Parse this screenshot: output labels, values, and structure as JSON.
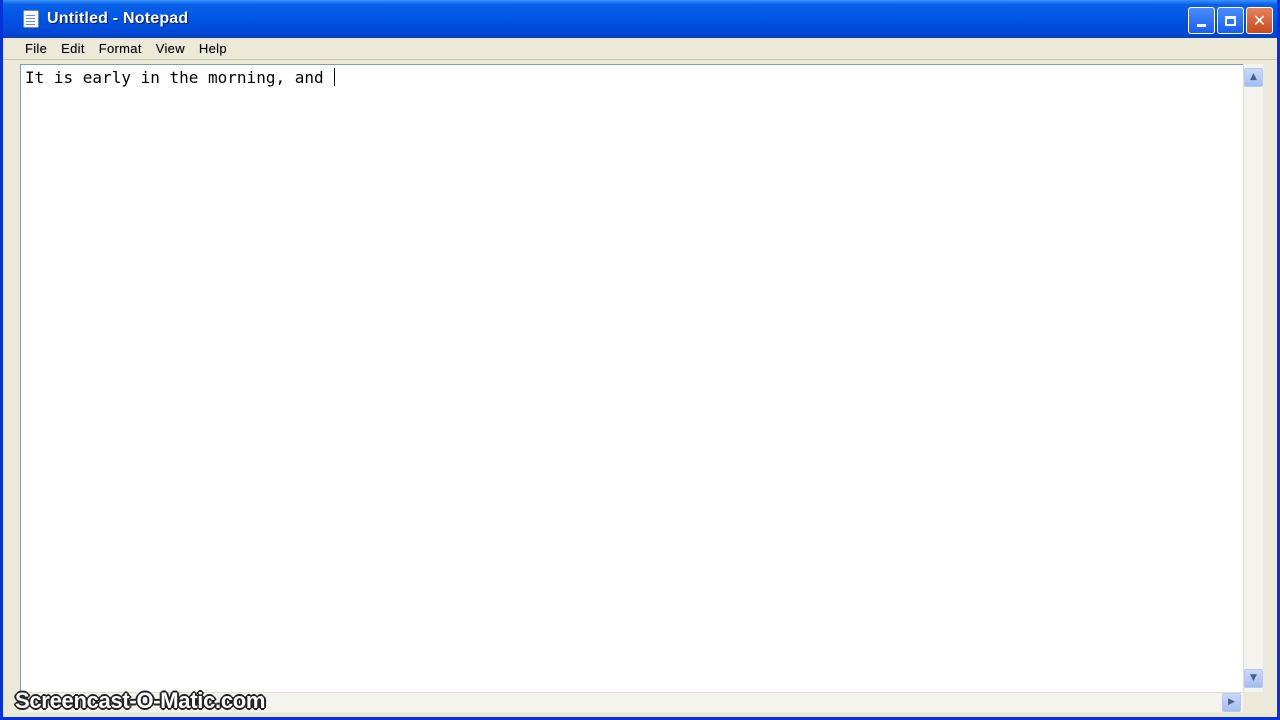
{
  "window": {
    "title": "Untitled - Notepad"
  },
  "menu": {
    "items": [
      "File",
      "Edit",
      "Format",
      "View",
      "Help"
    ]
  },
  "editor": {
    "text": "It is early in the morning, and "
  },
  "watermark": {
    "text": "Screencast-O-Matic.com"
  },
  "colors": {
    "titlebar": "#0055e5",
    "frame": "#0831d9",
    "menubar": "#ece9d8",
    "close_button": "#c84a1e"
  },
  "icons": {
    "app": "notepad-icon",
    "minimize": "minimize-icon",
    "maximize": "maximize-icon",
    "close": "close-icon"
  }
}
